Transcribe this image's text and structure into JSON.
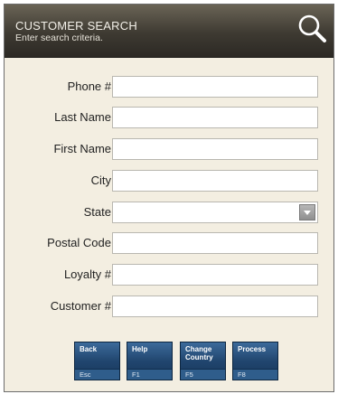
{
  "header": {
    "title": "CUSTOMER SEARCH",
    "subtitle": "Enter search criteria.",
    "icon": "search-icon"
  },
  "fields": [
    {
      "label": "Phone #",
      "value": ""
    },
    {
      "label": "Last Name",
      "value": ""
    },
    {
      "label": "First Name",
      "value": ""
    },
    {
      "label": "City",
      "value": ""
    },
    {
      "label": "State",
      "value": ""
    },
    {
      "label": "Postal Code",
      "value": ""
    },
    {
      "label": "Loyalty #",
      "value": ""
    },
    {
      "label": "Customer #",
      "value": ""
    }
  ],
  "function_keys": [
    {
      "label": "Back",
      "key": "Esc"
    },
    {
      "label": "Help",
      "key": "F1"
    },
    {
      "label": "Change Country",
      "key": "F5"
    },
    {
      "label": "Process",
      "key": "F8"
    }
  ],
  "colors": {
    "panel_background": "#f3eee1",
    "header_background": "#3e3a32",
    "button_blue": "#21466f"
  }
}
